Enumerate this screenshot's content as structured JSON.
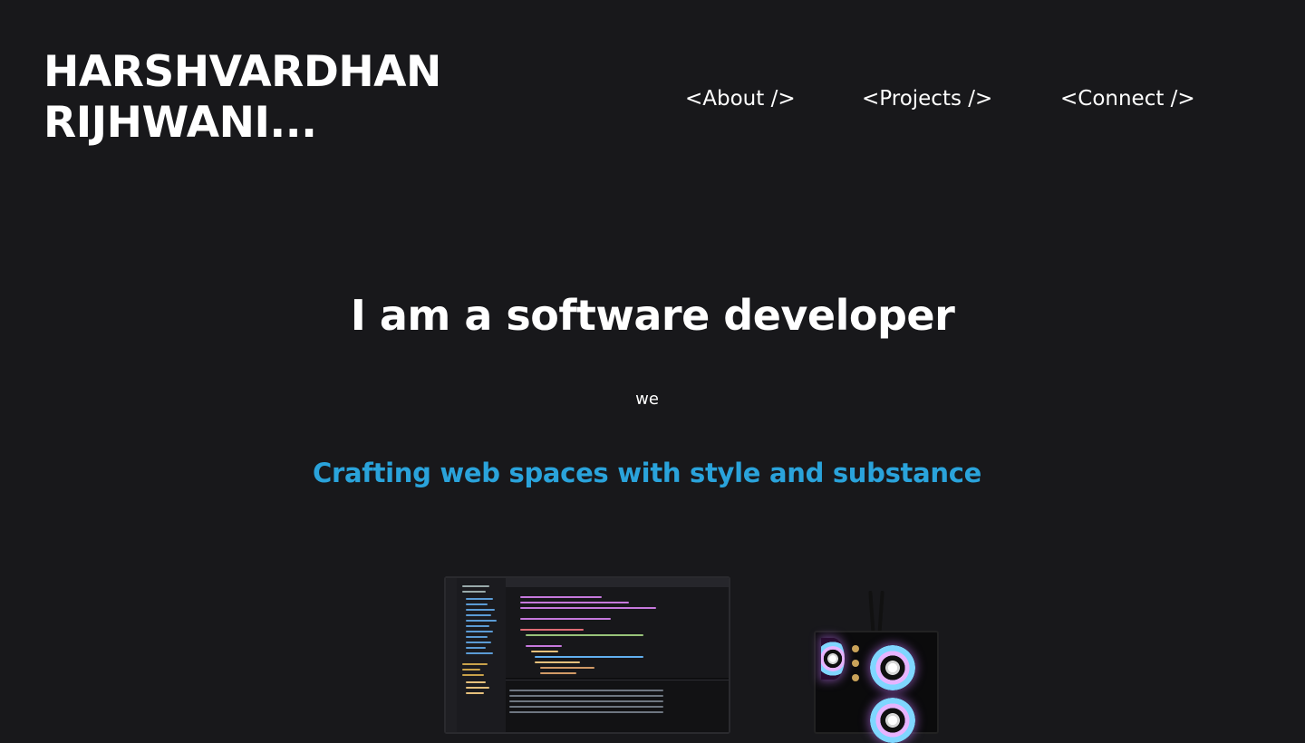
{
  "header": {
    "brand_line1": "HARSHVARDHAN",
    "brand_line2": "RIJHWANI..."
  },
  "nav": {
    "items": [
      {
        "label": "<About />"
      },
      {
        "label": "<Projects />"
      },
      {
        "label": "<Connect />"
      }
    ]
  },
  "hero": {
    "title": "I am a software developer",
    "small_text": "we",
    "subtitle": "Crafting web spaces with style and substance"
  },
  "colors": {
    "background": "#18181b",
    "accent": "#2aa3db",
    "text": "#ffffff"
  }
}
